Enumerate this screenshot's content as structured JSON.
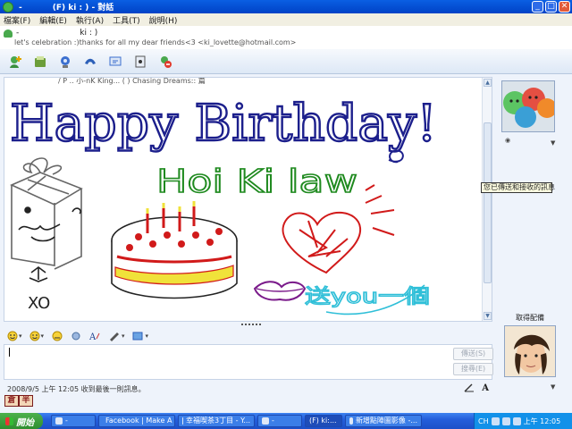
{
  "window": {
    "title": "(F) ki : ) - 對話",
    "title_prefix": "-",
    "title_gap": "-"
  },
  "menu": [
    "檔案(F)",
    "編輯(E)",
    "執行(A)",
    "工具(T)",
    "說明(H)"
  ],
  "contact": {
    "name_line": "ki : )",
    "name_prefix": "-",
    "personal_message": "let's celebration :)thanks for all my dear friends<3 <ki_lovette@hotmail.com>"
  },
  "chat": {
    "partial_line": "/ P .. 小-nK King...  (  ) Chasing Dreams:: 篇",
    "handwriting": {
      "line1": "Happy Birthday!",
      "line2": "Hoi Ki law",
      "line3": "送you一個",
      "gift_caption": "XO"
    },
    "ink_colors": {
      "navy": "#1c1f8c",
      "green": "#1f8a1f",
      "red": "#d11a1a",
      "cyan": "#2fbfd8",
      "purple": "#7a1a8a",
      "gray": "#555555",
      "yellow": "#f0e23a"
    }
  },
  "compose": {
    "send_label": "傳送(S)",
    "search_label": "搜尋(E)"
  },
  "status": {
    "last_message": "2008/9/5 上午 12:05 收到最後一則訊息。"
  },
  "ime": [
    "倉",
    "半"
  ],
  "tooltip": "您已傳送和接收的訊息",
  "right_panel": {
    "label": "取得配備"
  },
  "taskbar": {
    "start_label": "開始",
    "tasks": [
      {
        "label": "-",
        "active": false
      },
      {
        "label": "Facebook | Make A ...",
        "active": false
      },
      {
        "label": "幸福喫茶3丁目 - Y...",
        "active": false
      },
      {
        "label": "-",
        "active": false
      },
      {
        "label": "(F) ki:...",
        "active": true
      },
      {
        "label": "新增點陣圖影像 -...",
        "active": false
      }
    ],
    "tray_lang": "CH",
    "clock": "上午 12:05"
  }
}
